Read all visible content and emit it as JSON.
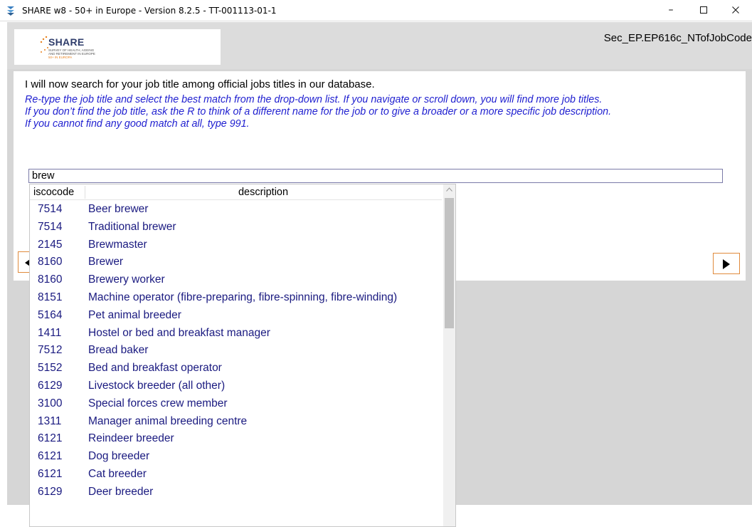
{
  "window": {
    "title": "SHARE w8 - 50+ in Europe - Version 8.2.5 - TT-001113-01-1",
    "minimize_glyph": "–",
    "icon": "share-app-icon"
  },
  "header": {
    "logo_text": "SHARE",
    "logo_subtitle_line1": "SURVEY OF HEALTH, AGEING",
    "logo_subtitle_line2": "AND RETIREMENT IN EUROPE",
    "logo_subtitle_line3": "50+ IN EUROPA",
    "section_code": "Sec_EP.EP616c_NTofJobCode"
  },
  "question": {
    "text": "I will now search for your job title among official jobs titles in our database.",
    "instructions": [
      "Re-type the job title and select the best match from the drop-down list. If you navigate or scroll down, you will find more job titles.",
      "If you don’t find the job title, ask the R to think of a different name for the job or to give a broader or a more specific job description.",
      "If you cannot find any good match at all, type 991."
    ]
  },
  "search": {
    "value": "brew"
  },
  "dropdown": {
    "columns": [
      "iscocode",
      "description"
    ],
    "rows": [
      {
        "code": "7514",
        "description": "Beer brewer"
      },
      {
        "code": "7514",
        "description": "Traditional brewer"
      },
      {
        "code": "2145",
        "description": "Brewmaster"
      },
      {
        "code": "8160",
        "description": "Brewer"
      },
      {
        "code": "8160",
        "description": "Brewery worker"
      },
      {
        "code": "8151",
        "description": "Machine operator (fibre-preparing, fibre-spinning, fibre-winding)"
      },
      {
        "code": "5164",
        "description": "Pet animal breeder"
      },
      {
        "code": "1411",
        "description": "Hostel or bed and breakfast manager"
      },
      {
        "code": "7512",
        "description": "Bread baker"
      },
      {
        "code": "5152",
        "description": "Bed and breakfast operator"
      },
      {
        "code": "6129",
        "description": "Livestock breeder (all other)"
      },
      {
        "code": "3100",
        "description": "Special forces crew member"
      },
      {
        "code": "1311",
        "description": "Manager animal breeding centre"
      },
      {
        "code": "6121",
        "description": "Reindeer breeder"
      },
      {
        "code": "6121",
        "description": "Dog breeder"
      },
      {
        "code": "6121",
        "description": "Cat breeder"
      },
      {
        "code": "6129",
        "description": "Deer breeder"
      }
    ]
  },
  "colors": {
    "instruction_blue": "#1f1fd0",
    "list_text": "#1a1a80",
    "nav_border": "#e08a3c",
    "background_gray": "#d6d6d6"
  },
  "icons": {
    "next": "play-right-icon",
    "prev": "play-left-icon"
  }
}
